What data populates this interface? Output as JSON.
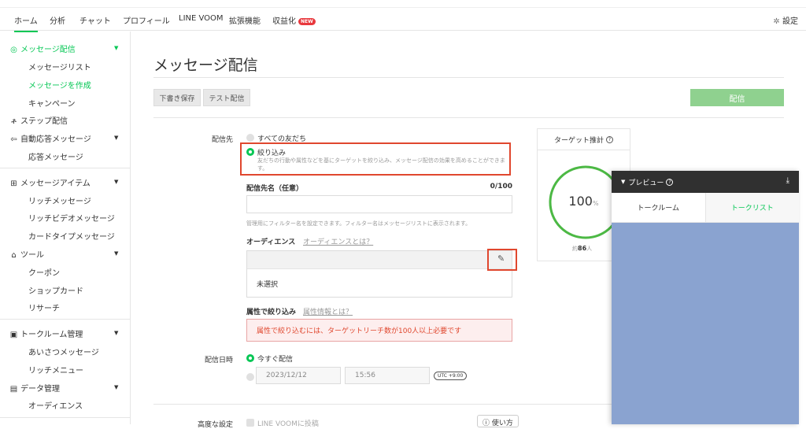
{
  "topnav": {
    "tabs": [
      "ホーム",
      "分析",
      "チャット",
      "プロフィール",
      "LINE VOOM",
      "拡張機能",
      "収益化"
    ],
    "new_badge": "NEW",
    "settings": "設定"
  },
  "sidebar": {
    "sections": [
      {
        "label": "メッセージ配信",
        "items": [
          "メッセージリスト",
          "メッセージを作成",
          "キャンペーン"
        ]
      },
      {
        "label": "ステップ配信"
      },
      {
        "label": "自動応答メッセージ",
        "items": [
          "応答メッセージ"
        ]
      },
      {
        "label": "メッセージアイテム",
        "items": [
          "リッチメッセージ",
          "リッチビデオメッセージ",
          "カードタイプメッセージ"
        ]
      },
      {
        "label": "ツール",
        "items": [
          "クーポン",
          "ショップカード",
          "リサーチ"
        ]
      },
      {
        "label": "トークルーム管理",
        "items": [
          "あいさつメッセージ",
          "リッチメニュー"
        ]
      },
      {
        "label": "データ管理",
        "items": [
          "オーディエンス"
        ]
      }
    ]
  },
  "page": {
    "title": "メッセージ配信",
    "draft_button": "下書き保存",
    "test_button": "テスト配信",
    "send_button": "配信"
  },
  "form": {
    "recipients_label": "配信先",
    "all_friends": "すべての友だち",
    "narrow": "絞り込み",
    "narrow_desc": "友だちの行動や属性などを基にターゲットを絞り込み、メッセージ配信の効果を高めることができます。",
    "name_label": "配信先名（任意）",
    "name_count": "0/100",
    "name_hint": "管理用にフィルター名を設定できます。フィルター名はメッセージリストに表示されます。",
    "audience_label": "オーディエンス",
    "audience_link": "オーディエンスとは？",
    "audience_value": "未選択",
    "attr_label": "属性で絞り込み",
    "attr_link": "属性情報とは？",
    "attr_error": "属性で絞り込むには、ターゲットリーチ数が100人以上必要です",
    "date_label": "配信日時",
    "send_now": "今すぐ配信",
    "date_value": "2023/12/12",
    "time_value": "15:56",
    "tz": "UTC +9:00",
    "advanced_label": "高度な設定",
    "voom_option": "LINE VOOMに投稿",
    "howto": "使い方"
  },
  "target": {
    "title": "ターゲット推計",
    "percent": "100",
    "percent_unit": "%",
    "percent_value": 100,
    "count_prefix": "約",
    "count": "86",
    "count_unit": "人"
  },
  "preview": {
    "title": "プレビュー",
    "tab_talkroom": "トークルーム",
    "tab_talklist": "トークリスト"
  },
  "colors": {
    "accent": "#06c755",
    "error": "#e0472e"
  }
}
